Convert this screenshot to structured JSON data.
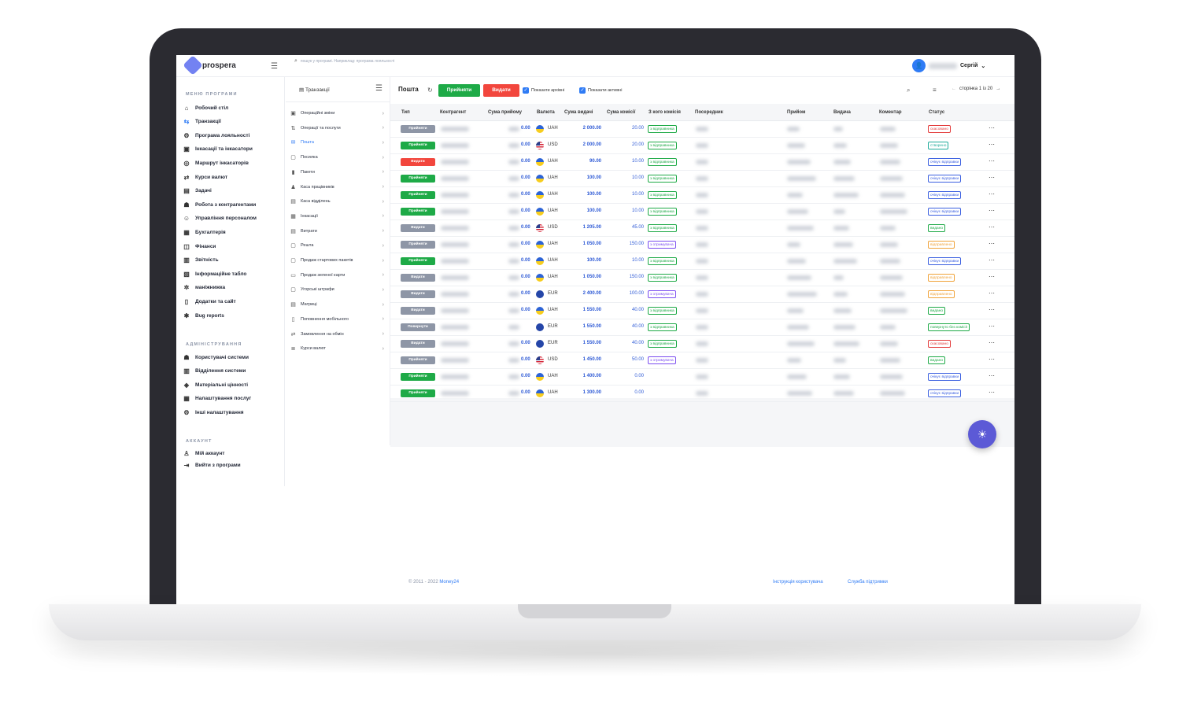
{
  "app": {
    "brand": "prospera"
  },
  "topbar": {
    "search_placeholder": "пошук у програмі. Наприклад: програма лояльності",
    "user_name": "Сергій"
  },
  "sidebar": {
    "program_title": "МЕНЮ ПРОГРАМИ",
    "program_items": [
      {
        "label": "Робочий стіл",
        "icon": "home-icon"
      },
      {
        "label": "Транзакції",
        "icon": "transactions-icon"
      },
      {
        "label": "Програма лояльності",
        "icon": "loyalty-icon"
      },
      {
        "label": "Інкасації та інкасатори",
        "icon": "cash-collection-icon"
      },
      {
        "label": "Маршрут інкасаторів",
        "icon": "route-icon"
      },
      {
        "label": "Курси валют",
        "icon": "exchange-icon"
      },
      {
        "label": "Задачі",
        "icon": "tasks-icon"
      },
      {
        "label": "Робота з контрагентами",
        "icon": "counterparty-icon"
      },
      {
        "label": "Управління персоналом",
        "icon": "staff-icon"
      },
      {
        "label": "Бухгалтерія",
        "icon": "accounting-icon"
      },
      {
        "label": "Фінанси",
        "icon": "finance-icon"
      },
      {
        "label": "Звітність",
        "icon": "reports-icon"
      },
      {
        "label": "Інформаційне табло",
        "icon": "dashboard-icon"
      },
      {
        "label": "маніжнижка",
        "icon": "gear-star-icon"
      },
      {
        "label": "Додатки та сайт",
        "icon": "mobile-icon"
      },
      {
        "label": "Bug reports",
        "icon": "bug-icon"
      }
    ],
    "admin_title": "АДМІНІСТРУВАННЯ",
    "admin_items": [
      {
        "label": "Користувачі системи",
        "icon": "users-icon"
      },
      {
        "label": "Відділення системи",
        "icon": "branch-icon"
      },
      {
        "label": "Матеріальні цінності",
        "icon": "assets-icon"
      },
      {
        "label": "Налаштування послуг",
        "icon": "services-icon"
      },
      {
        "label": "Інші налаштування",
        "icon": "settings-icon"
      }
    ],
    "account_title": "АККАУНТ",
    "account_items": [
      {
        "label": "Мій аккаунт",
        "icon": "user-icon"
      },
      {
        "label": "Вийти з програми",
        "icon": "logout-icon"
      }
    ]
  },
  "subnav": {
    "title": "Транзакції",
    "items": [
      {
        "label": "Операційні зміни"
      },
      {
        "label": "Операції та послуги"
      },
      {
        "label": "Пошта"
      },
      {
        "label": "Посилка"
      },
      {
        "label": "Пакети"
      },
      {
        "label": "Каса працівників"
      },
      {
        "label": "Каса відділень"
      },
      {
        "label": "Інкасації"
      },
      {
        "label": "Витрати"
      },
      {
        "label": "Решта"
      },
      {
        "label": "Продаж стартових пакетів"
      },
      {
        "label": "Продаж зеленої карти"
      },
      {
        "label": "Угорські штрафи"
      },
      {
        "label": "Матриці"
      },
      {
        "label": "Поповнення мобільного"
      },
      {
        "label": "Замовлення на обмін"
      },
      {
        "label": "Курси валют"
      }
    ]
  },
  "toolbar": {
    "title": "Пошта",
    "accept_label": "Прийняти",
    "issue_label": "Видати",
    "show_archived": "Показати архівні",
    "show_active": "Показати активні",
    "pager_text": "сторінка 1 із 20"
  },
  "table": {
    "headers": [
      "Тип",
      "Контрагент",
      "Сума прийому",
      "Валюта",
      "Сума видачі",
      "Сума комісії",
      "З кого комісія",
      "Посередник",
      "Прийом",
      "Видача",
      "Коментар",
      "Статус"
    ],
    "rows": [
      {
        "type": "Прийняти",
        "type_color": "#8e96a6",
        "recv": "0.00",
        "currency": "UAH",
        "amount": "2 000.00",
        "fee": "20.00",
        "from": "з відправника",
        "status": "скасовано",
        "status_kind": "cancel"
      },
      {
        "type": "Прийняти",
        "type_color": "#1eaa47",
        "recv": "0.00",
        "currency": "USD",
        "amount": "2 000.00",
        "fee": "20.00",
        "from": "з відправника",
        "status": "створено",
        "status_kind": "created"
      },
      {
        "type": "Видати",
        "type_color": "#f2463d",
        "recv": "0.00",
        "currency": "UAH",
        "amount": "90.00",
        "fee": "10.00",
        "from": "з відправника",
        "status": "очікує відправки",
        "status_kind": "wait"
      },
      {
        "type": "Прийняти",
        "type_color": "#1eaa47",
        "recv": "0.00",
        "currency": "UAH",
        "amount": "100.00",
        "fee": "10.00",
        "from": "з відправника",
        "status": "очікує відправки",
        "status_kind": "wait"
      },
      {
        "type": "Прийняти",
        "type_color": "#1eaa47",
        "recv": "0.00",
        "currency": "UAH",
        "amount": "100.00",
        "fee": "10.00",
        "from": "з відправника",
        "status": "очікує відправки",
        "status_kind": "wait"
      },
      {
        "type": "Прийняти",
        "type_color": "#1eaa47",
        "recv": "0.00",
        "currency": "UAH",
        "amount": "100.00",
        "fee": "10.00",
        "from": "з відправника",
        "status": "очікує відправки",
        "status_kind": "wait"
      },
      {
        "type": "Видати",
        "type_color": "#8e96a6",
        "recv": "0.00",
        "currency": "USD",
        "amount": "1 205.00",
        "fee": "45.00",
        "from": "з відправника",
        "status": "видано",
        "status_kind": "issued"
      },
      {
        "type": "Прийняти",
        "type_color": "#8e96a6",
        "recv": "0.00",
        "currency": "UAH",
        "amount": "1 050.00",
        "fee": "150.00",
        "from": "з отримувача",
        "status": "відправлено",
        "status_kind": "sent"
      },
      {
        "type": "Прийняти",
        "type_color": "#1eaa47",
        "recv": "0.00",
        "currency": "UAH",
        "amount": "100.00",
        "fee": "10.00",
        "from": "з відправника",
        "status": "очікує відправки",
        "status_kind": "wait"
      },
      {
        "type": "Видати",
        "type_color": "#8e96a6",
        "recv": "0.00",
        "currency": "UAH",
        "amount": "1 050.00",
        "fee": "150.00",
        "from": "з відправника",
        "status": "відправлено",
        "status_kind": "sent"
      },
      {
        "type": "Видати",
        "type_color": "#8e96a6",
        "recv": "0.00",
        "currency": "EUR",
        "amount": "2 400.00",
        "fee": "100.00",
        "from": "з отримувача",
        "status": "відправлено",
        "status_kind": "sent"
      },
      {
        "type": "Видати",
        "type_color": "#8e96a6",
        "recv": "0.00",
        "currency": "UAH",
        "amount": "1 550.00",
        "fee": "40.00",
        "from": "з відправника",
        "status": "видано",
        "status_kind": "issued"
      },
      {
        "type": "Повернути",
        "type_color": "#8e96a6",
        "recv": "",
        "currency": "EUR",
        "amount": "1 550.00",
        "fee": "40.00",
        "from": "з відправника",
        "status": "повернуто без комісії",
        "status_kind": "back"
      },
      {
        "type": "Видати",
        "type_color": "#8e96a6",
        "recv": "0.00",
        "currency": "EUR",
        "amount": "1 550.00",
        "fee": "40.00",
        "from": "з відправника",
        "status": "скасовано",
        "status_kind": "cancel"
      },
      {
        "type": "Прийняти",
        "type_color": "#8e96a6",
        "recv": "0.00",
        "currency": "USD",
        "amount": "1 450.00",
        "fee": "50.00",
        "from": "з отримувача",
        "status": "видано",
        "status_kind": "issued"
      },
      {
        "type": "Прийняти",
        "type_color": "#1eaa47",
        "recv": "0.00",
        "currency": "UAH",
        "amount": "1 400.00",
        "fee": "0.00",
        "from": "",
        "status": "очікує відправки",
        "status_kind": "wait"
      },
      {
        "type": "Прийняти",
        "type_color": "#1eaa47",
        "recv": "0.00",
        "currency": "UAH",
        "amount": "1 300.00",
        "fee": "0.00",
        "from": "",
        "status": "очікує відправки",
        "status_kind": "wait"
      }
    ]
  },
  "footer": {
    "copyright": "© 2011 - 2022",
    "brand": "Money24",
    "link_manual": "Інструкція користувача",
    "link_support": "Служба підтримки"
  }
}
